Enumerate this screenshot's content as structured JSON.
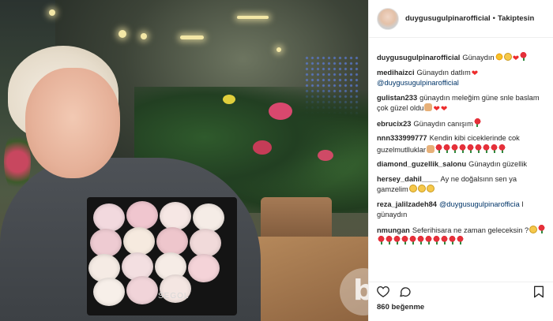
{
  "post": {
    "likes_text": "860 beğenme",
    "photo_box_text": "SEGOL",
    "watermark_glyph": "b"
  },
  "header": {
    "username": "duygusugulpinarofficial",
    "separator": "•",
    "follow_label": "Takiptesin"
  },
  "comments": [
    {
      "author": "duygusugulpinarofficial",
      "text": "Günaydın",
      "emojis": [
        "sun",
        "smile",
        "heart",
        "rose-e"
      ]
    },
    {
      "author": "medihaizci",
      "text": "Günaydın datlım",
      "emojis": [
        "heart"
      ],
      "mention": "@duygusugulpinarofficial"
    },
    {
      "author": "gulistan233",
      "text": "günaydın meleğim güne snle baslam çok güzel oldu",
      "emojis": [
        "hands",
        "heart",
        "heart"
      ]
    },
    {
      "author": "ebrucix23",
      "text": "Günaydın canışım",
      "emojis": [
        "rose-e"
      ]
    },
    {
      "author": "nnn333999777",
      "text": "Kendin kibi ciceklerinde cok guzelmutlluklar",
      "emojis": [
        "hands",
        "rose-e",
        "rose-e",
        "rose-e",
        "rose-e",
        "rose-e",
        "rose-e",
        "rose-e",
        "rose-e",
        "rose-e"
      ]
    },
    {
      "author": "diamond_guzellik_salonu",
      "text": "Günaydın güzellik",
      "emojis": []
    },
    {
      "author": "hersey_dahil____",
      "text": "Ay ne doğalsınn sen ya gamzelim",
      "emojis": [
        "smile",
        "smile",
        "smile"
      ]
    },
    {
      "author": "reza_jalilzadeh84",
      "text": "l günaydın",
      "emojis": [],
      "mention_before": "@duygusugulpinarofficia"
    },
    {
      "author": "nmungan",
      "text": "Seferihisara ne zaman geleceksin ?",
      "emojis": [
        "smile",
        "rose-e",
        "rose-e",
        "rose-e",
        "rose-e",
        "rose-e",
        "rose-e",
        "rose-e",
        "rose-e",
        "rose-e",
        "rose-e",
        "rose-e",
        "rose-e"
      ]
    }
  ],
  "icons": {
    "like": "heart-outline-icon",
    "comment": "speech-bubble-icon",
    "save": "bookmark-icon"
  },
  "colors": {
    "text": "#262626",
    "mention": "#003569",
    "heart": "#ed2c2c",
    "border": "#efefef"
  }
}
